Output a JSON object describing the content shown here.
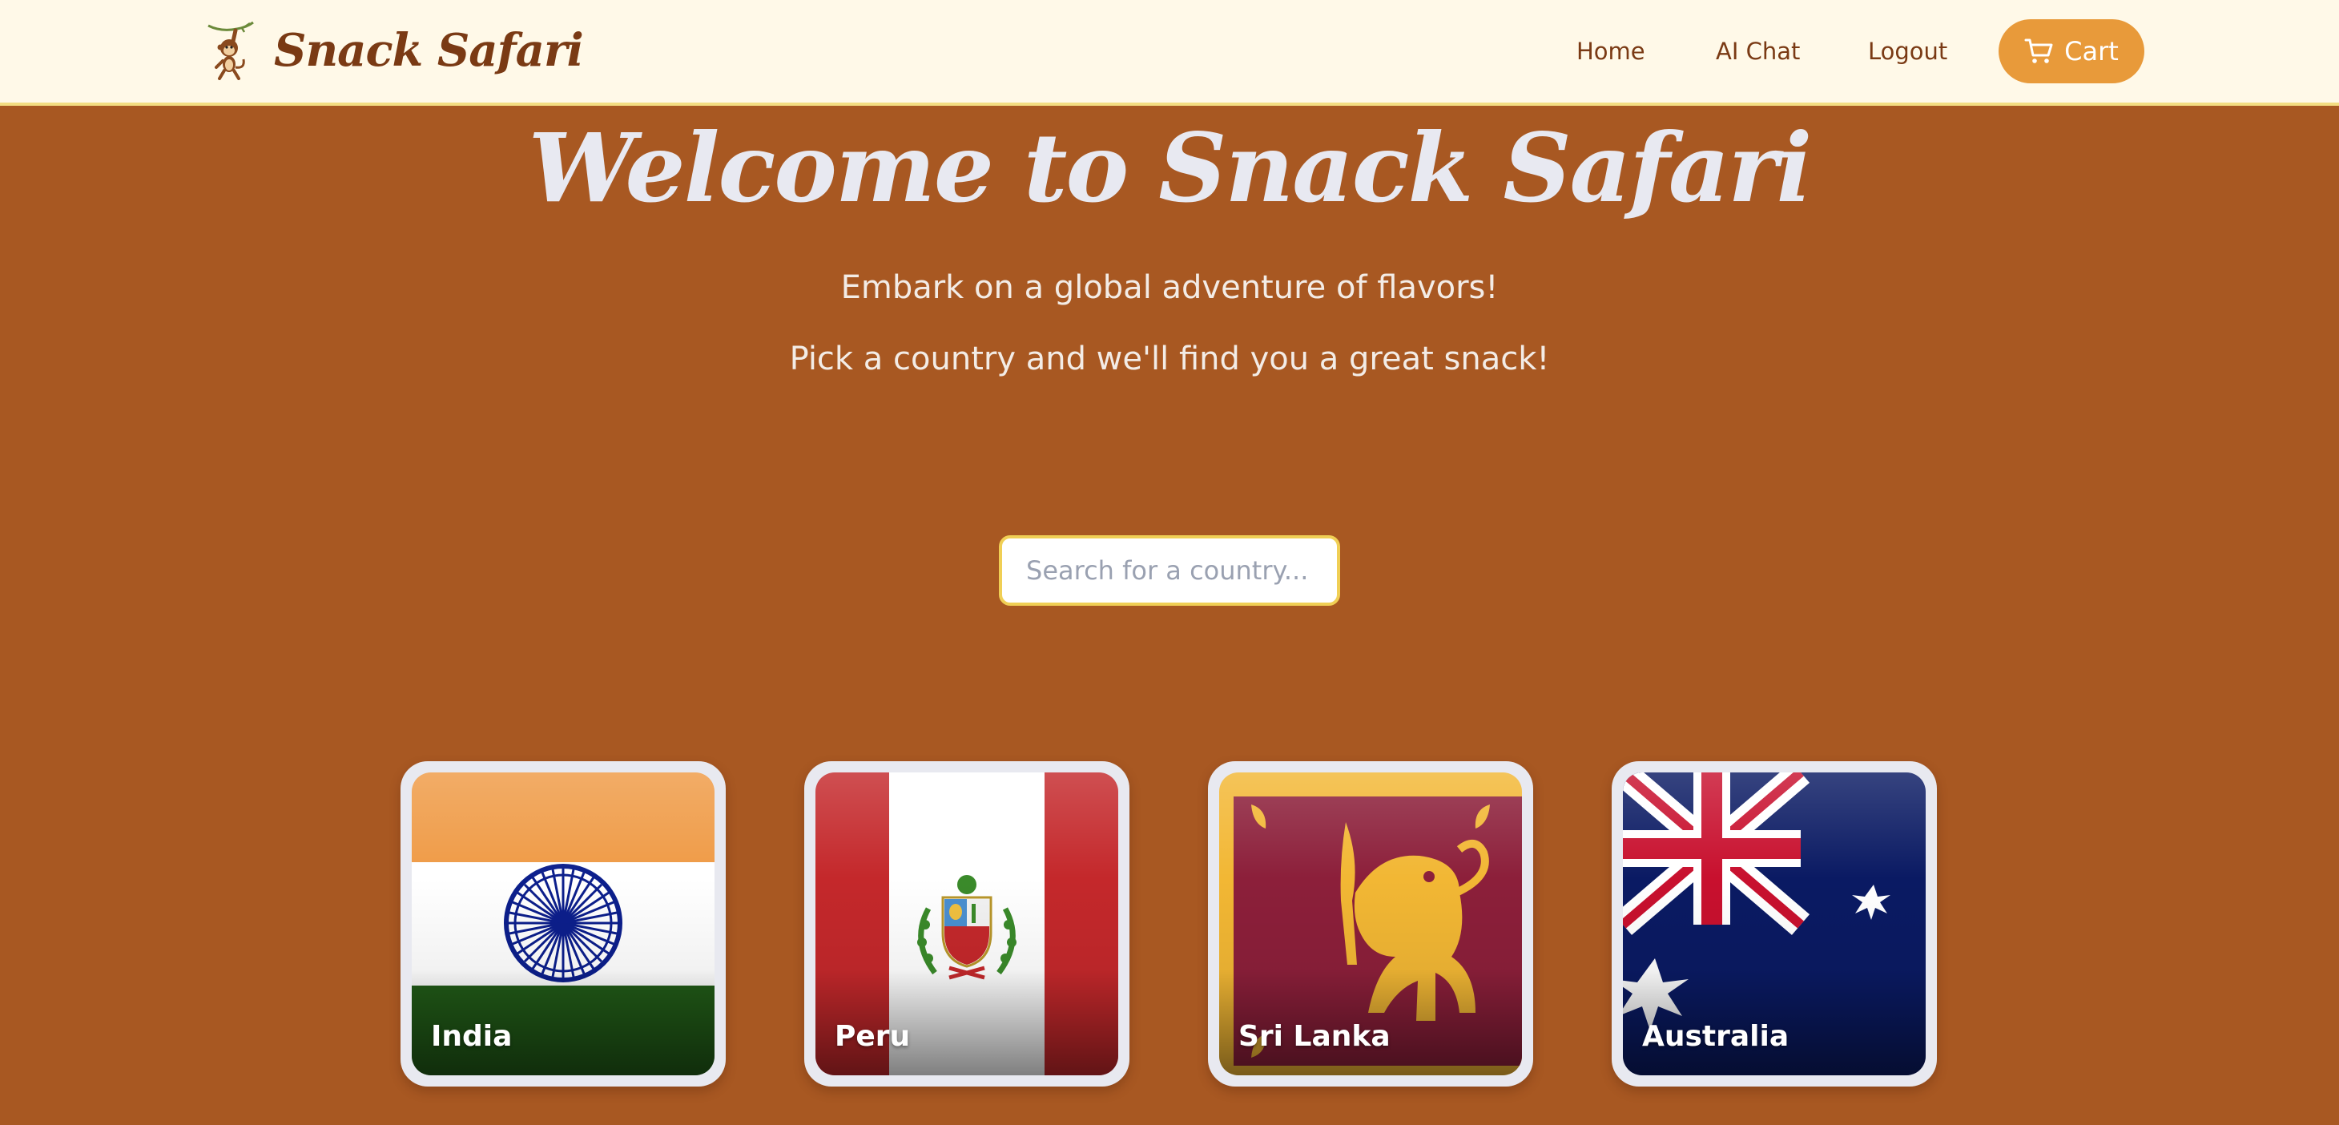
{
  "brand": {
    "name": "Snack Safari",
    "logo_icon": "monkey-logo-icon"
  },
  "nav": {
    "home": "Home",
    "ai_chat": "AI Chat",
    "logout": "Logout",
    "cart": "Cart",
    "cart_icon": "shopping-cart-icon"
  },
  "hero": {
    "title": "Welcome to Snack Safari",
    "subtitle1": "Embark on a global adventure of flavors!",
    "subtitle2": "Pick a country and we'll find you a great snack!"
  },
  "search": {
    "placeholder": "Search for a country..."
  },
  "countries": [
    {
      "name": "India"
    },
    {
      "name": "Peru"
    },
    {
      "name": "Sri Lanka"
    },
    {
      "name": "Australia"
    }
  ],
  "colors": {
    "background": "#a85822",
    "navbar": "#fff9e8",
    "brand_text": "#7a3a14",
    "cart_button": "#e89a3a",
    "search_border": "#f0cf55"
  }
}
